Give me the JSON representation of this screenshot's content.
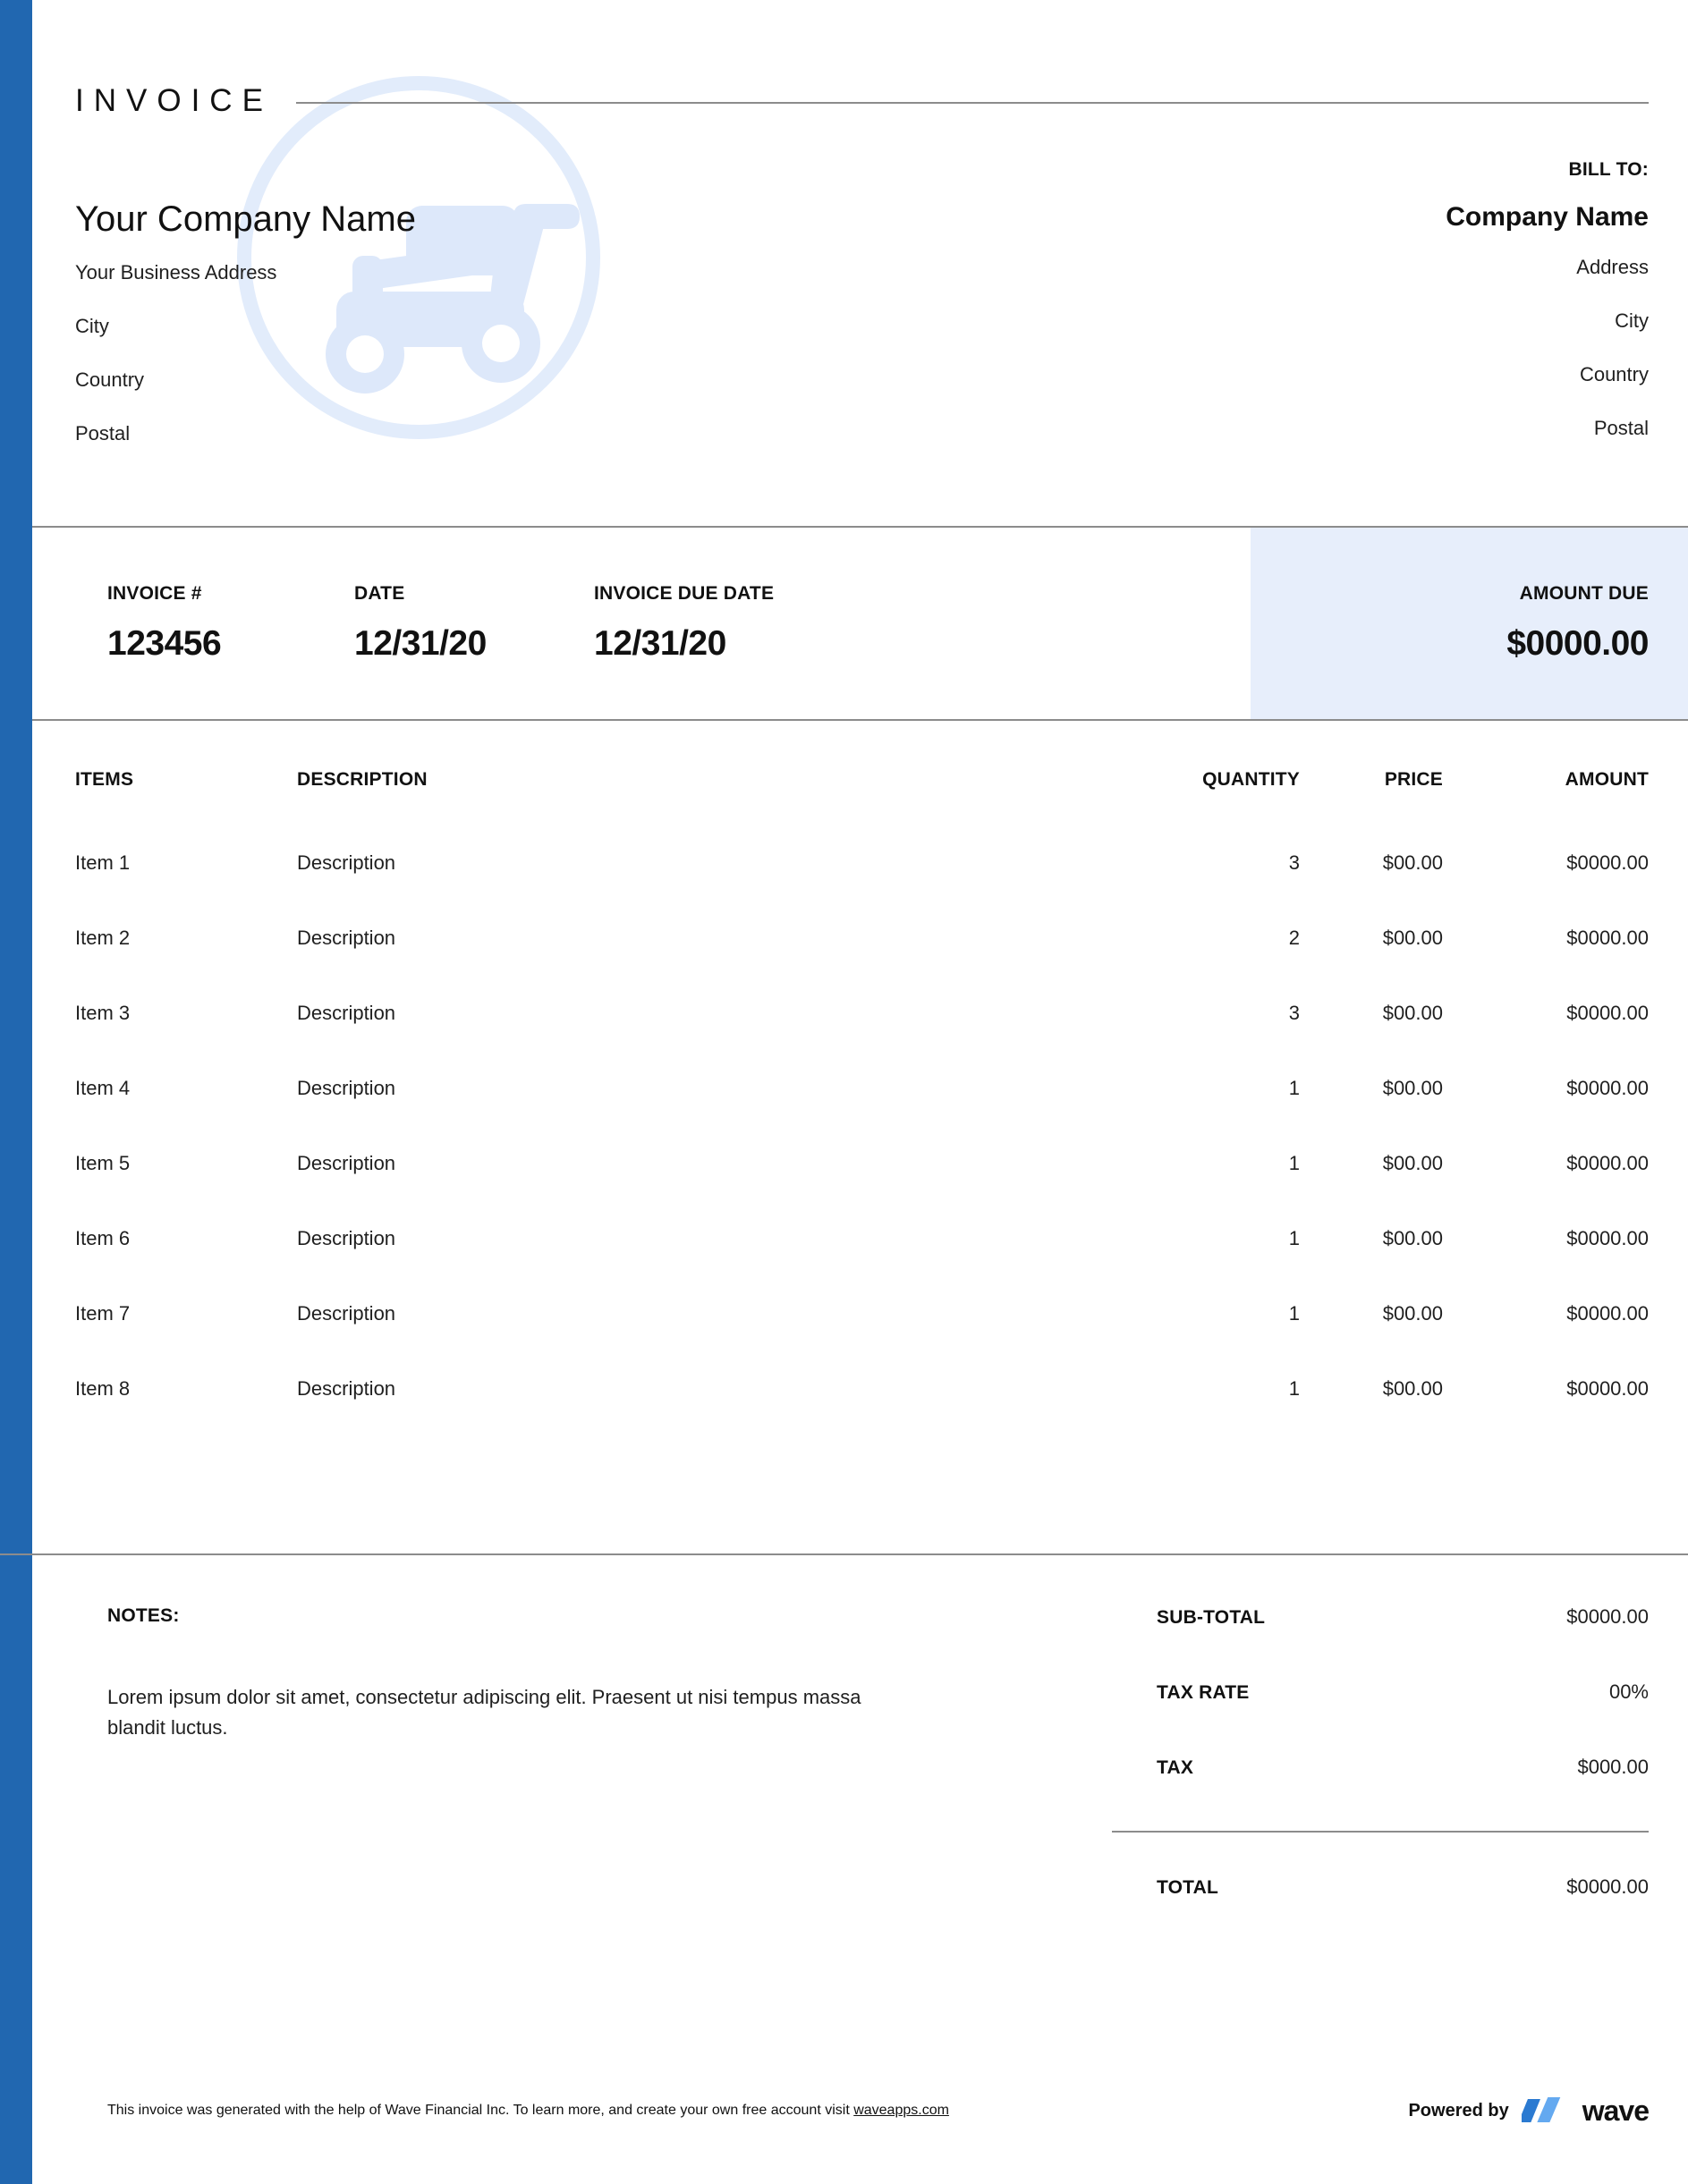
{
  "document": {
    "heading": "INVOICE"
  },
  "seller": {
    "company_name": "Your Company Name",
    "address_lines": [
      "Your Business Address",
      "City",
      "Country",
      "Postal"
    ]
  },
  "bill_to": {
    "label": "BILL TO:",
    "company_name": "Company Name",
    "address_lines": [
      "Address",
      "City",
      "Country",
      "Postal"
    ]
  },
  "meta": {
    "invoice_number_label": "INVOICE #",
    "invoice_number_value": "123456",
    "date_label": "DATE",
    "date_value": "12/31/20",
    "due_date_label": "INVOICE DUE DATE",
    "due_date_value": "12/31/20",
    "amount_due_label": "AMOUNT DUE",
    "amount_due_value": "$0000.00"
  },
  "items_table": {
    "headers": {
      "items": "ITEMS",
      "description": "DESCRIPTION",
      "quantity": "QUANTITY",
      "price": "PRICE",
      "amount": "AMOUNT"
    },
    "rows": [
      {
        "item": "Item 1",
        "description": "Description",
        "quantity": "3",
        "price": "$00.00",
        "amount": "$0000.00"
      },
      {
        "item": "Item 2",
        "description": "Description",
        "quantity": "2",
        "price": "$00.00",
        "amount": "$0000.00"
      },
      {
        "item": "Item 3",
        "description": "Description",
        "quantity": "3",
        "price": "$00.00",
        "amount": "$0000.00"
      },
      {
        "item": "Item 4",
        "description": "Description",
        "quantity": "1",
        "price": "$00.00",
        "amount": "$0000.00"
      },
      {
        "item": "Item 5",
        "description": "Description",
        "quantity": "1",
        "price": "$00.00",
        "amount": "$0000.00"
      },
      {
        "item": "Item 6",
        "description": "Description",
        "quantity": "1",
        "price": "$00.00",
        "amount": "$0000.00"
      },
      {
        "item": "Item 7",
        "description": "Description",
        "quantity": "1",
        "price": "$00.00",
        "amount": "$0000.00"
      },
      {
        "item": "Item 8",
        "description": "Description",
        "quantity": "1",
        "price": "$00.00",
        "amount": "$0000.00"
      }
    ]
  },
  "notes": {
    "label": "NOTES:",
    "text": "Lorem ipsum dolor sit amet, consectetur adipiscing elit. Praesent ut nisi tempus massa blandit luctus."
  },
  "totals": {
    "subtotal_label": "SUB-TOTAL",
    "subtotal_value": "$0000.00",
    "tax_rate_label": "TAX RATE",
    "tax_rate_value": "00%",
    "tax_label": "TAX",
    "tax_value": "$000.00",
    "total_label": "TOTAL",
    "total_value": "$0000.00"
  },
  "footer": {
    "note_prefix": "This invoice was generated with the help of Wave Financial Inc. To learn more, and create your own free account visit ",
    "link_text": "waveapps.com",
    "powered_by_text": "Powered by",
    "brand_name": "wave"
  },
  "colors": {
    "accent_bar": "#2167b0",
    "amount_due_background": "#e7eefb",
    "rule": "#8c8c8c",
    "watermark": "#dfe9fa",
    "wave_logo_dark": "#2b7ad1",
    "wave_logo_light": "#64a9f0"
  },
  "watermark": {
    "icon_name": "lawn-mower-in-circle-icon"
  }
}
